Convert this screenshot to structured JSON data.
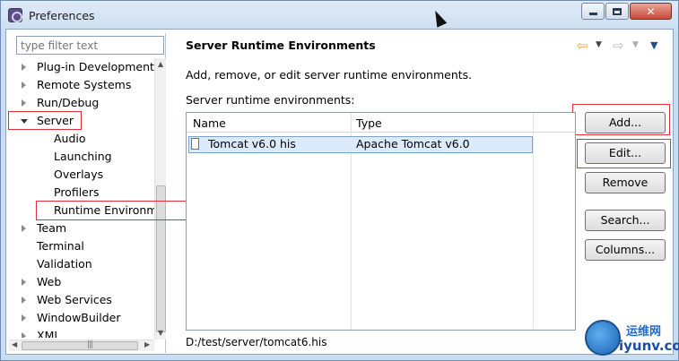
{
  "window": {
    "title": "Preferences",
    "background_text": ""
  },
  "left": {
    "filter_placeholder": "type filter text",
    "tree": [
      {
        "label": "Plug-in Development",
        "indent": 0,
        "twisty": "closed"
      },
      {
        "label": "Remote Systems",
        "indent": 0,
        "twisty": "closed"
      },
      {
        "label": "Run/Debug",
        "indent": 0,
        "twisty": "closed"
      },
      {
        "label": "Server",
        "indent": 0,
        "twisty": "open"
      },
      {
        "label": "Audio",
        "indent": 1,
        "twisty": "none"
      },
      {
        "label": "Launching",
        "indent": 1,
        "twisty": "none"
      },
      {
        "label": "Overlays",
        "indent": 1,
        "twisty": "none"
      },
      {
        "label": "Profilers",
        "indent": 1,
        "twisty": "none"
      },
      {
        "label": "Runtime Environm",
        "indent": 1,
        "twisty": "none"
      },
      {
        "label": "Team",
        "indent": 0,
        "twisty": "closed"
      },
      {
        "label": "Terminal",
        "indent": 0,
        "twisty": "none"
      },
      {
        "label": "Validation",
        "indent": 0,
        "twisty": "none"
      },
      {
        "label": "Web",
        "indent": 0,
        "twisty": "closed"
      },
      {
        "label": "Web Services",
        "indent": 0,
        "twisty": "closed"
      },
      {
        "label": "WindowBuilder",
        "indent": 0,
        "twisty": "closed"
      },
      {
        "label": "XML",
        "indent": 0,
        "twisty": "closed"
      }
    ]
  },
  "main": {
    "title": "Server Runtime Environments",
    "description": "Add, remove, or edit server runtime environments.",
    "list_label": "Server runtime environments:",
    "columns": [
      "Name",
      "Type"
    ],
    "rows": [
      {
        "name": "Tomcat v6.0 his",
        "type": "Apache Tomcat v6.0"
      }
    ],
    "buttons": {
      "add": "Add...",
      "edit": "Edit...",
      "remove": "Remove",
      "search": "Search...",
      "columns": "Columns..."
    },
    "location": "D:/test/server/tomcat6.his"
  },
  "watermark": {
    "line1": "运维网",
    "line2": "iyunv.com"
  },
  "colors": {
    "highlight": "#e0303a",
    "selection": "#dcebfc",
    "nav_arrow": "#e8a33d"
  }
}
